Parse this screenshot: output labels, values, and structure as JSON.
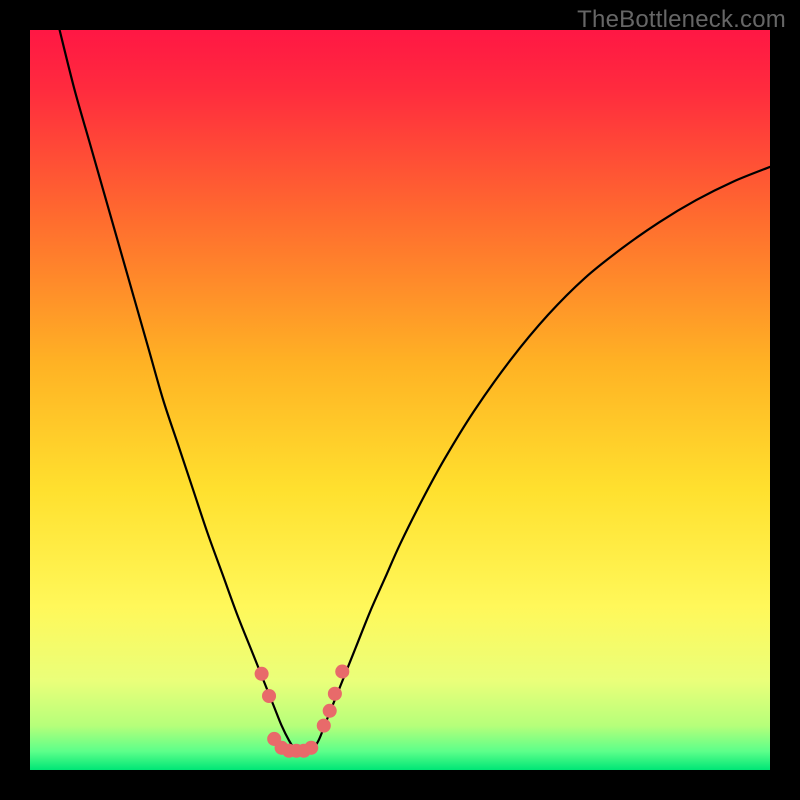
{
  "watermark": "TheBottleneck.com",
  "chart_data": {
    "type": "line",
    "title": "",
    "xlabel": "",
    "ylabel": "",
    "xlim": [
      0,
      100
    ],
    "ylim": [
      0,
      100
    ],
    "gradient_stops": [
      {
        "offset": 0.0,
        "color": "#ff1744"
      },
      {
        "offset": 0.08,
        "color": "#ff2b3e"
      },
      {
        "offset": 0.25,
        "color": "#ff6a2f"
      },
      {
        "offset": 0.45,
        "color": "#ffb224"
      },
      {
        "offset": 0.62,
        "color": "#ffe02e"
      },
      {
        "offset": 0.78,
        "color": "#fff85a"
      },
      {
        "offset": 0.88,
        "color": "#eaff7a"
      },
      {
        "offset": 0.94,
        "color": "#b6ff7a"
      },
      {
        "offset": 0.975,
        "color": "#5cff8a"
      },
      {
        "offset": 1.0,
        "color": "#00e676"
      }
    ],
    "series": [
      {
        "name": "bottleneck-curve",
        "x": [
          4.0,
          6.0,
          8.0,
          10.0,
          12.0,
          14.0,
          16.0,
          18.0,
          20.0,
          22.0,
          24.0,
          26.0,
          28.0,
          30.0,
          31.0,
          32.0,
          33.0,
          34.0,
          35.0,
          36.0,
          37.0,
          38.0,
          39.0,
          40.0,
          42.0,
          44.0,
          46.0,
          48.0,
          50.0,
          53.0,
          56.0,
          60.0,
          65.0,
          70.0,
          75.0,
          80.0,
          85.0,
          90.0,
          95.0,
          100.0
        ],
        "y": [
          100.0,
          92.0,
          85.0,
          78.0,
          71.0,
          64.0,
          57.0,
          50.0,
          44.0,
          38.0,
          32.0,
          26.5,
          21.0,
          16.0,
          13.5,
          11.0,
          8.5,
          6.0,
          4.0,
          2.5,
          2.0,
          2.5,
          4.0,
          6.5,
          11.5,
          16.5,
          21.5,
          26.0,
          30.5,
          36.5,
          42.0,
          48.5,
          55.5,
          61.5,
          66.5,
          70.5,
          74.0,
          77.0,
          79.5,
          81.5
        ]
      }
    ],
    "markers": {
      "name": "highlight-dots",
      "color": "#e86a6a",
      "radius_percent": 0.95,
      "points": [
        {
          "x": 31.3,
          "y": 13.0
        },
        {
          "x": 32.3,
          "y": 10.0
        },
        {
          "x": 33.0,
          "y": 4.2
        },
        {
          "x": 34.0,
          "y": 3.0
        },
        {
          "x": 35.0,
          "y": 2.6
        },
        {
          "x": 36.0,
          "y": 2.6
        },
        {
          "x": 37.0,
          "y": 2.6
        },
        {
          "x": 38.0,
          "y": 3.0
        },
        {
          "x": 39.7,
          "y": 6.0
        },
        {
          "x": 40.5,
          "y": 8.0
        },
        {
          "x": 41.2,
          "y": 10.3
        },
        {
          "x": 42.2,
          "y": 13.3
        }
      ]
    }
  }
}
